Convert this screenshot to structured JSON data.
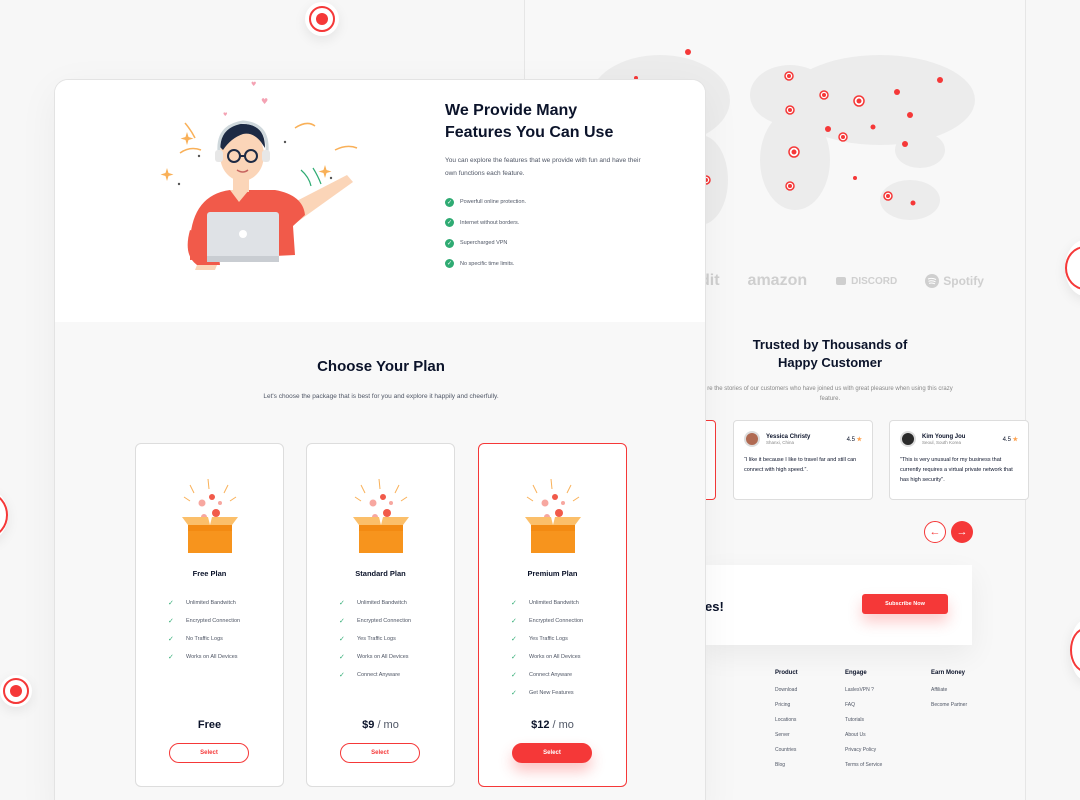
{
  "features": {
    "title_line1": "We Provide Many",
    "title_line2": "Features You Can Use",
    "description": "You can explore the features that we provide with fun and have their own functions each feature.",
    "items": [
      "Powerfull online protection.",
      "Internet without borders.",
      "Supercharged VPN",
      "No specific time limits."
    ]
  },
  "plans": {
    "title": "Choose Your Plan",
    "description": "Let's choose the package that is best for you and explore it happily and cheerfully.",
    "cards": [
      {
        "name": "Free Plan",
        "features": [
          "Unlimited Bandwitch",
          "Encrypted Connection",
          "No Traffic Logs",
          "Works on All Devices"
        ],
        "price": "Free",
        "unit": "",
        "button": "Select"
      },
      {
        "name": "Standard Plan",
        "features": [
          "Unlimited Bandwitch",
          "Encrypted Connection",
          "Yes Traffic Logs",
          "Works on All Devices",
          "Connect Anyware"
        ],
        "price": "$9",
        "unit": " / mo",
        "button": "Select"
      },
      {
        "name": "Premium Plan",
        "features": [
          "Unlimited Bandwitch",
          "Encrypted Connection",
          "Yes Traffic Logs",
          "Works on All Devices",
          "Connect Anyware",
          "Get New Features"
        ],
        "price": "$12",
        "unit": " / mo",
        "button": "Select"
      }
    ]
  },
  "brands": [
    "dit",
    "amazon",
    "DISCORD",
    "Spotify"
  ],
  "testimonials": {
    "title_line1": "Trusted by Thousands of",
    "title_line2": "Happy Customer",
    "description": "re the stories of our customers who have joined us with great pleasure when using this crazy feature.",
    "cards": [
      {
        "name": "Yessica Christy",
        "location": "Shanxi, China",
        "rating": "4.5",
        "quote": "“I like it because I like to travel far and still can connect with high speed.”."
      },
      {
        "name": "Kim Young Jou",
        "location": "Seoul, South Korea",
        "rating": "4.5",
        "quote": "\"This is very unusual for my business that currently requires a virtual private network that has high security\"."
      }
    ],
    "prev_icon": "←",
    "next_icon": "→"
  },
  "subscribe": {
    "text_line1": "r",
    "text_line2": "res!",
    "button": "Subscribe Now"
  },
  "footer": {
    "columns": [
      {
        "heading": "Product",
        "links": [
          "Download",
          "Pricing",
          "Locations",
          "Server",
          "Countries",
          "Blog"
        ]
      },
      {
        "heading": "Engage",
        "links": [
          "LaslesVPN ?",
          "FAQ",
          "Tutorials",
          "About Us",
          "Privacy Policy",
          "Terms of Service"
        ]
      },
      {
        "heading": "Earn Money",
        "links": [
          "Affiliate",
          "Become Partner"
        ]
      }
    ]
  },
  "colors": {
    "accent": "#f53838",
    "check": "#2fab73",
    "star": "#fea250",
    "text": "#0b132a"
  },
  "icons": {
    "check": "✓",
    "star": "★"
  }
}
